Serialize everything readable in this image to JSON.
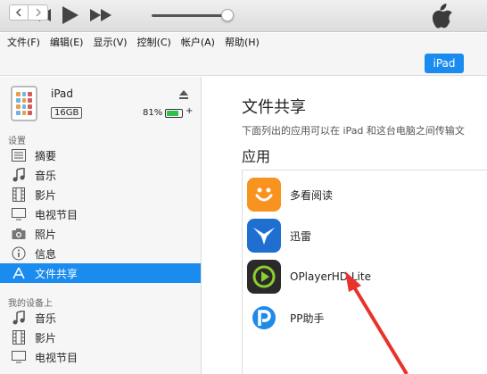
{
  "menu": [
    "文件(F)",
    "编辑(E)",
    "显示(V)",
    "控制(C)",
    "帐户(A)",
    "帮助(H)"
  ],
  "device": {
    "button_label": "iPad",
    "name": "iPad",
    "capacity": "16GB",
    "battery_percent_text": "81%",
    "battery_level": 0.81,
    "charging_symbol": "+"
  },
  "sidebar": {
    "settings_label": "设置",
    "settings_items": [
      {
        "label": "摘要",
        "icon": "summary-icon"
      },
      {
        "label": "音乐",
        "icon": "music-icon"
      },
      {
        "label": "影片",
        "icon": "film-icon"
      },
      {
        "label": "电视节目",
        "icon": "tv-icon"
      },
      {
        "label": "照片",
        "icon": "camera-icon"
      },
      {
        "label": "信息",
        "icon": "info-icon"
      },
      {
        "label": "文件共享",
        "icon": "app-store-icon",
        "selected": true
      }
    ],
    "my_device_label": "我的设备上",
    "my_device_items": [
      {
        "label": "音乐",
        "icon": "music-icon"
      },
      {
        "label": "影片",
        "icon": "film-icon"
      },
      {
        "label": "电视节目",
        "icon": "tv-icon"
      }
    ]
  },
  "main": {
    "title": "文件共享",
    "description": "下面列出的应用可以在 iPad 和这台电脑之间传输文",
    "apps_heading": "应用",
    "apps": [
      {
        "name": "多看阅读",
        "color": "#f7931e"
      },
      {
        "name": "迅雷",
        "color": "#1f6fd1"
      },
      {
        "name": "OPlayerHD Lite",
        "color": "#2a2a2a"
      },
      {
        "name": "PP助手",
        "color": "#ffffff"
      }
    ]
  },
  "colors": {
    "accent": "#1a8cf0",
    "annotation_arrow": "#e8322b"
  }
}
